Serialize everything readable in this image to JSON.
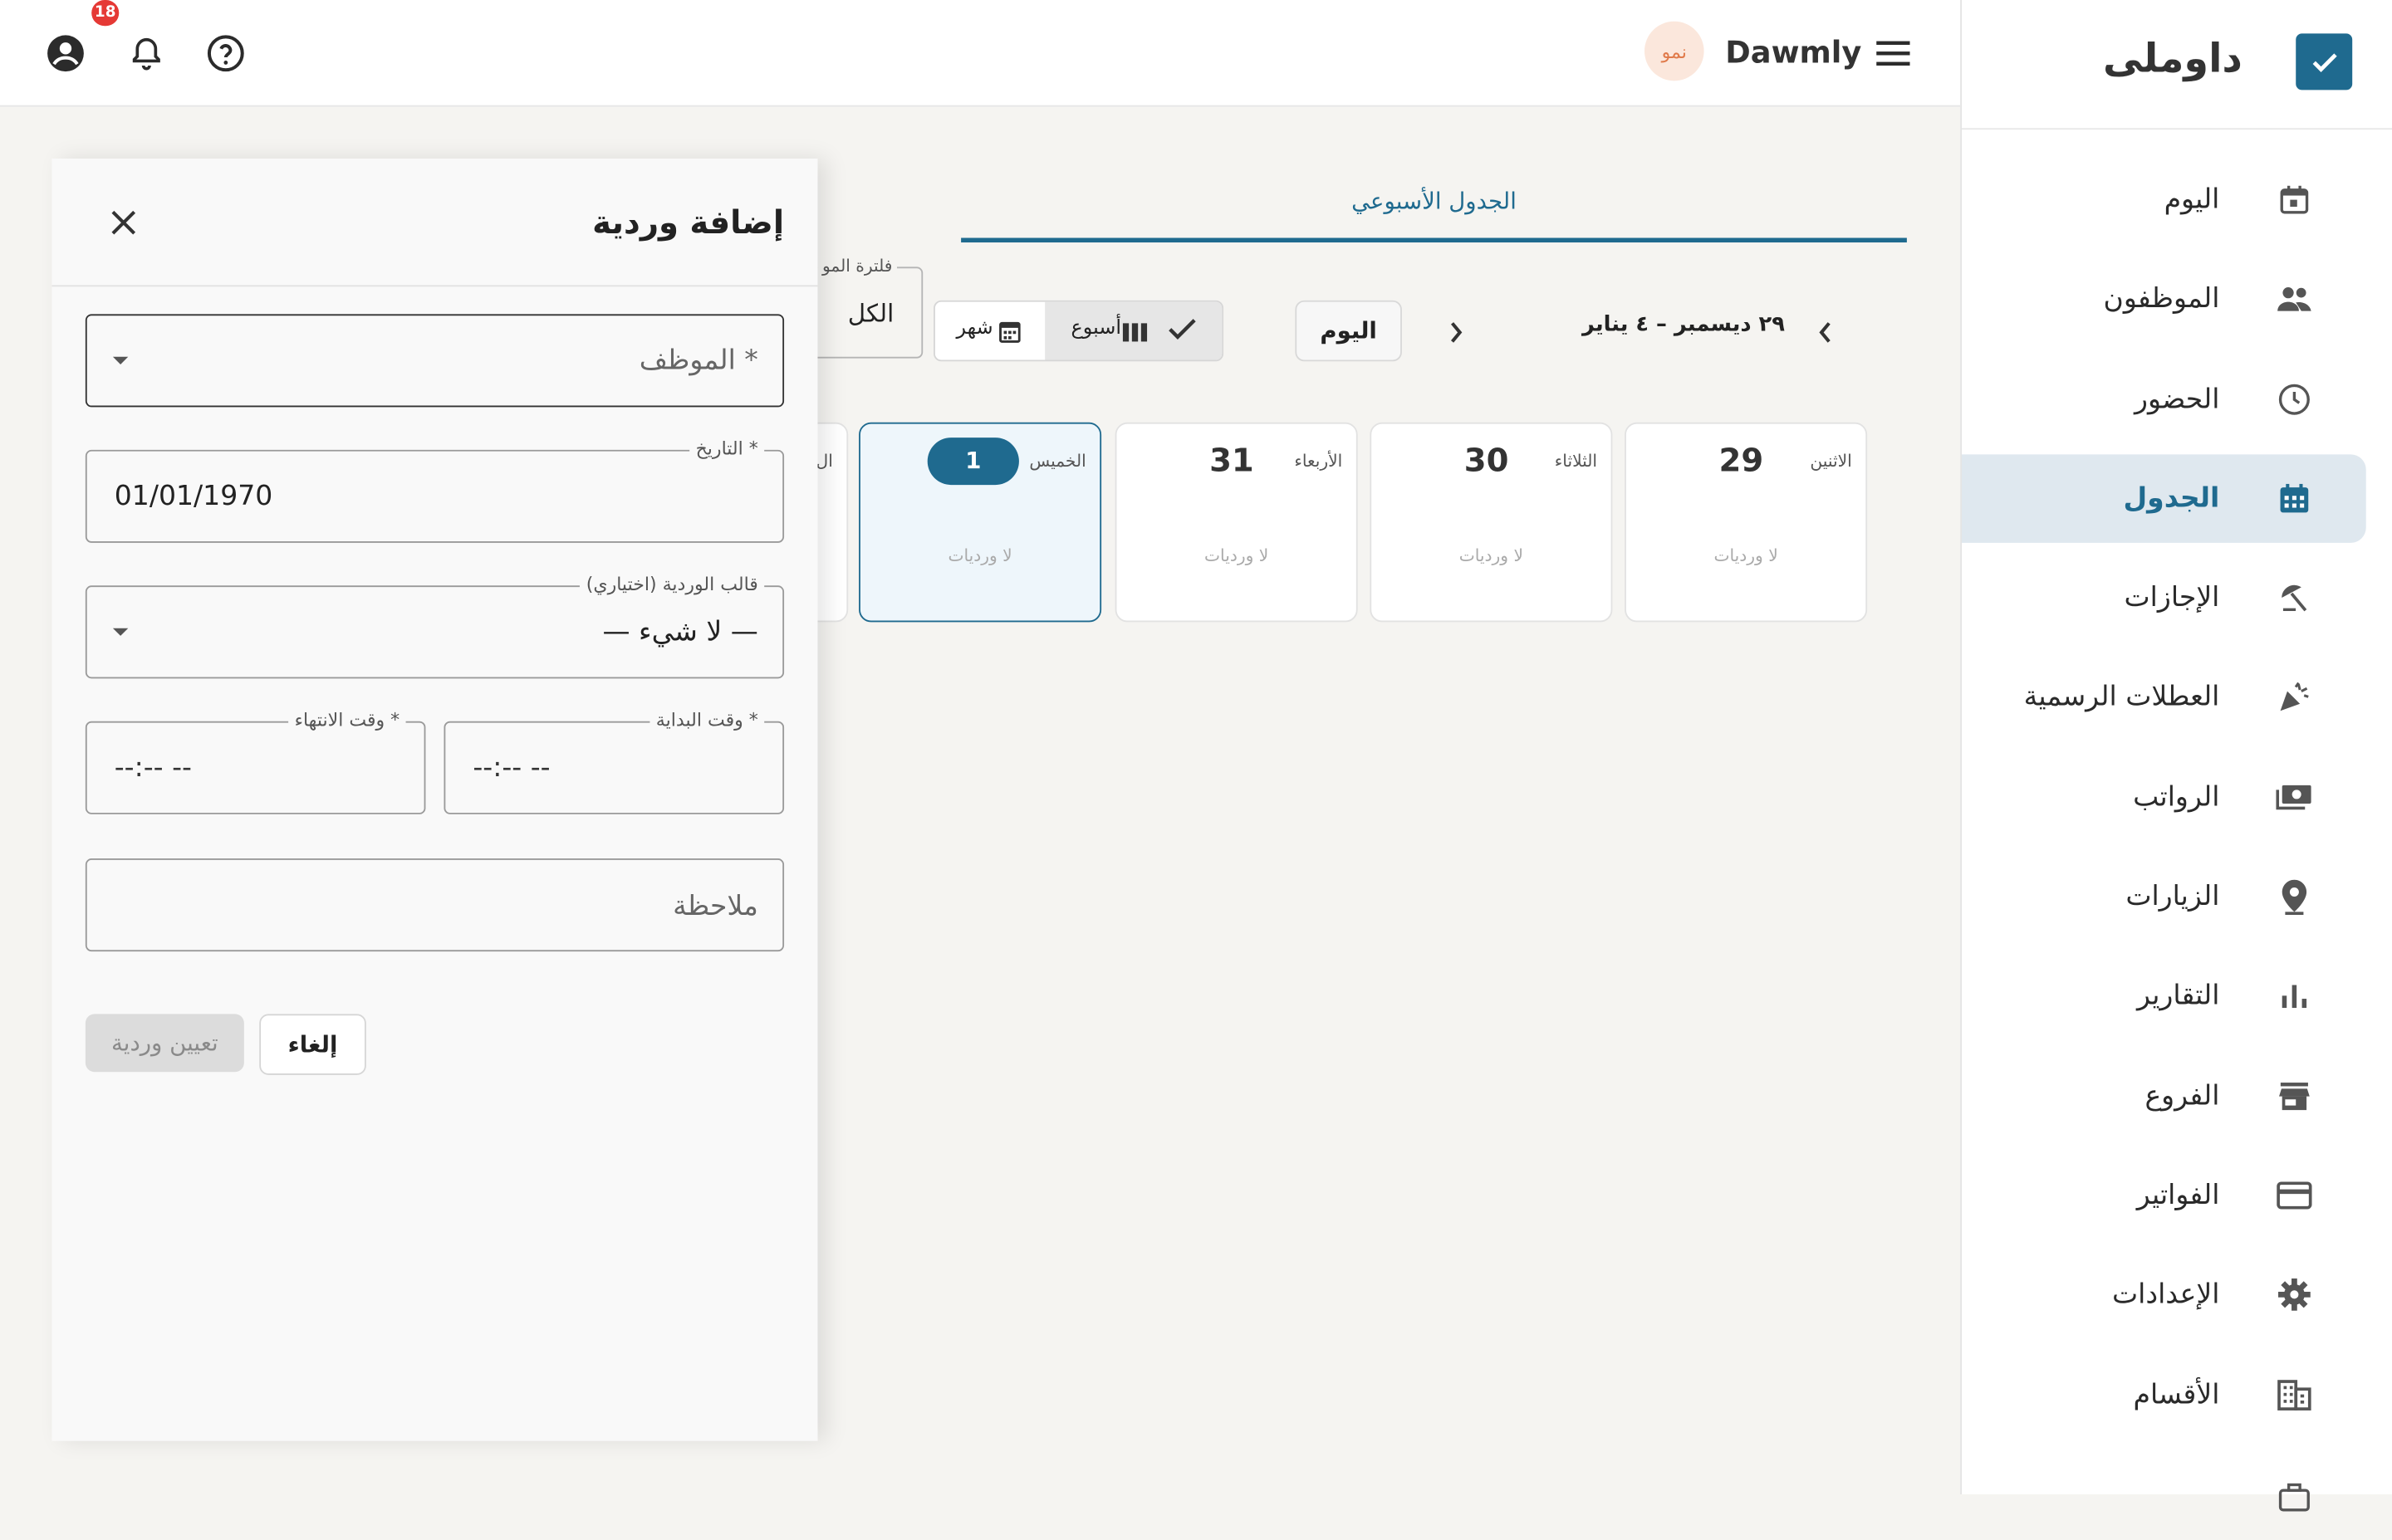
{
  "topbar": {
    "brand": "Dawmly",
    "avatar_text": "نمو",
    "notification_count": "18"
  },
  "sidebar": {
    "app_title": "داوملى",
    "items": [
      {
        "label": "اليوم",
        "icon": "calendar-today-icon"
      },
      {
        "label": "الموظفون",
        "icon": "people-icon"
      },
      {
        "label": "الحضور",
        "icon": "clock-icon"
      },
      {
        "label": "الجدول",
        "icon": "calendar-grid-icon",
        "active": true
      },
      {
        "label": "الإجازات",
        "icon": "beach-umbrella-icon"
      },
      {
        "label": "العطلات الرسمية",
        "icon": "celebration-icon"
      },
      {
        "label": "الرواتب",
        "icon": "payments-icon"
      },
      {
        "label": "الزيارات",
        "icon": "location-pin-icon"
      },
      {
        "label": "التقارير",
        "icon": "bar-chart-icon"
      },
      {
        "label": "الفروع",
        "icon": "store-icon"
      },
      {
        "label": "الفواتير",
        "icon": "credit-card-icon"
      },
      {
        "label": "الإعدادات",
        "icon": "gear-icon"
      },
      {
        "label": "الأقسام",
        "icon": "building-icon"
      }
    ]
  },
  "main": {
    "tab_weekly": "الجدول الأسبوعي",
    "date_range": "٢٩ ديسمبر – ٤ يناير",
    "today_button": "اليوم",
    "view_week": "أسبوع",
    "view_month": "شهر",
    "filter_label": "فلترة المو",
    "filter_value": "الكل",
    "days": [
      {
        "name": "الاثنين",
        "num": "29",
        "empty": "لا ورديات"
      },
      {
        "name": "الثلاثاء",
        "num": "30",
        "empty": "لا ورديات"
      },
      {
        "name": "الأربعاء",
        "num": "31",
        "empty": "لا ورديات"
      },
      {
        "name": "الخميس",
        "num": "1",
        "empty": "لا ورديات",
        "today": true
      },
      {
        "name": "ال",
        "num": "",
        "empty": ""
      }
    ]
  },
  "drawer": {
    "title": "إضافة وردية",
    "employee_placeholder": "الموظف *",
    "date_label": "التاريخ *",
    "date_value": "01/01/1970",
    "template_label": "قالب الوردية (اختياري)",
    "template_value": "— لا شيء —",
    "start_label": "وقت البداية *",
    "start_value": "--:-- --",
    "end_label": "وقت الانتهاء *",
    "end_value": "--:-- --",
    "note_placeholder": "ملاحظة",
    "submit_label": "تعيين وردية",
    "cancel_label": "إلغاء"
  },
  "colors": {
    "primary": "#1f6a8f",
    "badge": "#e53935",
    "active_nav_bg": "#dfe8ef"
  }
}
